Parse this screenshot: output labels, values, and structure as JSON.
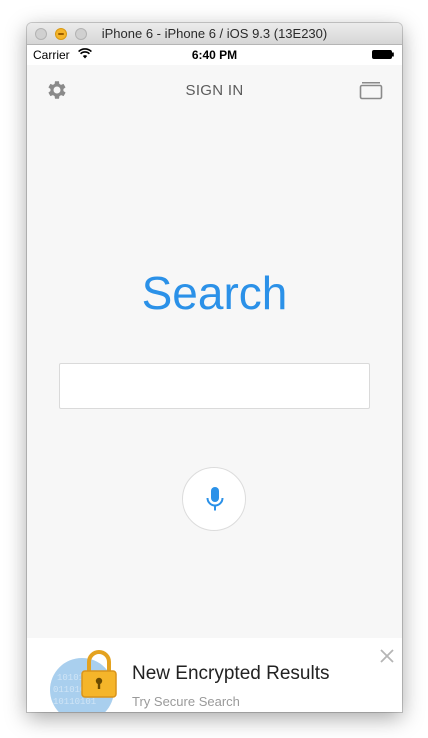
{
  "window": {
    "title": "iPhone 6 - iPhone 6 / iOS 9.3 (13E230)"
  },
  "status_bar": {
    "carrier": "Carrier",
    "time": "6:40 PM"
  },
  "nav": {
    "sign_in": "SIGN IN",
    "settings_icon": "gear-icon",
    "tabs_icon": "tabs-icon"
  },
  "main": {
    "logo_text": "Search",
    "search_value": "",
    "search_placeholder": "",
    "mic_icon": "microphone-icon"
  },
  "promo": {
    "title": "New Encrypted Results",
    "subtitle": "Try Secure Search",
    "icon": "padlock-icon",
    "close_icon": "close-icon"
  },
  "colors": {
    "accent": "#2b91e8",
    "lock": "#f5b52a"
  }
}
